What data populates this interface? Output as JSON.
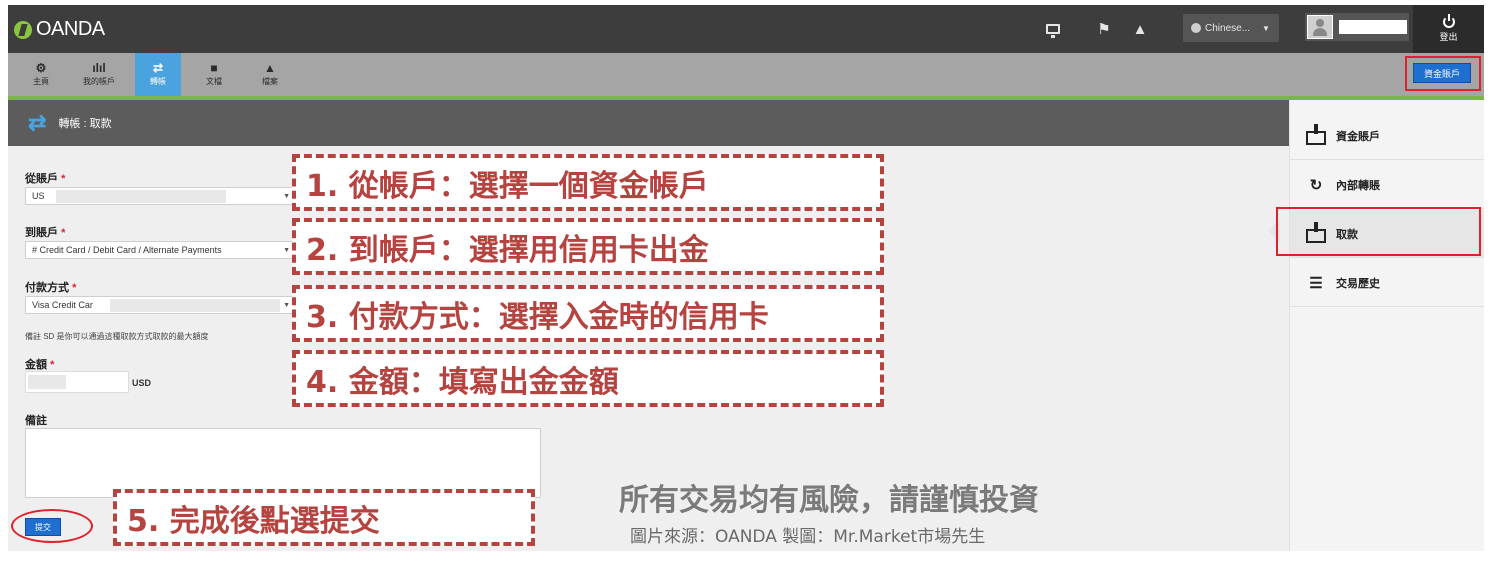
{
  "brand": {
    "name": "OANDA"
  },
  "header": {
    "language": "Chinese...",
    "logout_label": "登出",
    "icons": [
      "monitor-icon",
      "flag-icon",
      "warning-icon"
    ]
  },
  "nav": {
    "items": [
      {
        "label": "主頁",
        "glyph": "⚙"
      },
      {
        "label": "我的帳戶",
        "glyph": "ılıl"
      },
      {
        "label": "轉帳",
        "glyph": "⇄"
      },
      {
        "label": "文檔",
        "glyph": "■"
      },
      {
        "label": "檔案",
        "glyph": "▲"
      }
    ],
    "active_index": 2,
    "fund_button": "資金賬戶"
  },
  "page": {
    "title": "轉帳 : 取款"
  },
  "form": {
    "from_label": "從賬戶",
    "from_value": "US",
    "to_label": "到賬戶",
    "to_value": "# Credit Card / Debit Card / Alternate Payments",
    "method_label": "付款方式",
    "method_value": "Visa Credit Car",
    "note": "備註        SD 是你可以通過這種取款方式取款的最大額度",
    "amount_label": "金額",
    "currency": "USD",
    "remark_label": "備註",
    "submit": "提交",
    "required_mark": "*"
  },
  "callouts": {
    "step1": "1. 從帳戶：選擇一個資金帳戶",
    "step2": "2. 到帳戶：選擇用信用卡出金",
    "step3": "3. 付款方式：選擇入金時的信用卡",
    "step4": "4. 金額：填寫出金金額",
    "step5": "5. 完成後點選提交"
  },
  "footer": {
    "disclaimer": "所有交易均有風險，請謹慎投資",
    "source": "圖片來源：OANDA 製圖：Mr.Market市場先生"
  },
  "sidebar": {
    "items": [
      {
        "label": "資金賬戶"
      },
      {
        "label": "內部轉賬"
      },
      {
        "label": "取款"
      },
      {
        "label": "交易歷史"
      }
    ]
  },
  "colors": {
    "accent_blue": "#1f6fd1",
    "active_tab": "#4aa3df",
    "annotation_red": "#b5433f",
    "highlight_red": "#e0202a",
    "green_bar": "#7ab648"
  }
}
